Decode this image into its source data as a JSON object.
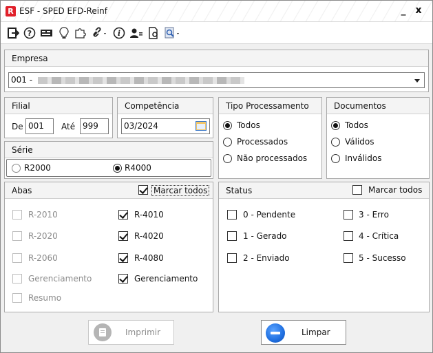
{
  "window": {
    "title": "ESF - SPED EFD-Reinf",
    "minimize": "_",
    "close": "x"
  },
  "toolbar": {
    "icons": [
      "exit-icon",
      "help-icon",
      "card-icon",
      "lightbulb-icon",
      "puzzle-icon",
      "link-icon",
      "info-icon",
      "user-icon",
      "document-settings-icon",
      "search-report-icon"
    ]
  },
  "empresa": {
    "header": "Empresa",
    "value": "001 -"
  },
  "filial": {
    "header": "Filial",
    "de_label": "De",
    "de_value": "001",
    "ate_label": "Até",
    "ate_value": "999"
  },
  "competencia": {
    "header": "Competência",
    "value": "03/2024"
  },
  "serie": {
    "header": "Série",
    "options": [
      {
        "label": "R2000",
        "selected": false
      },
      {
        "label": "R4000",
        "selected": true
      }
    ]
  },
  "tipo_processamento": {
    "header": "Tipo Processamento",
    "options": [
      {
        "label": "Todos",
        "selected": true
      },
      {
        "label": "Processados",
        "selected": false
      },
      {
        "label": "Não processados",
        "selected": false
      }
    ]
  },
  "documentos": {
    "header": "Documentos",
    "options": [
      {
        "label": "Todos",
        "selected": true
      },
      {
        "label": "Válidos",
        "selected": false
      },
      {
        "label": "Inválidos",
        "selected": false
      }
    ]
  },
  "abas": {
    "header": "Abas",
    "marcar_todos": "Marcar todos",
    "marcar_todos_checked": true,
    "left": [
      {
        "label": "R-2010",
        "checked": false,
        "disabled": true
      },
      {
        "label": "R-2020",
        "checked": false,
        "disabled": true
      },
      {
        "label": "R-2060",
        "checked": false,
        "disabled": true
      },
      {
        "label": "Gerenciamento",
        "checked": false,
        "disabled": true
      },
      {
        "label": "Resumo",
        "checked": false,
        "disabled": true
      }
    ],
    "right": [
      {
        "label": "R-4010",
        "checked": true,
        "disabled": false
      },
      {
        "label": "R-4020",
        "checked": true,
        "disabled": false
      },
      {
        "label": "R-4080",
        "checked": true,
        "disabled": false
      },
      {
        "label": "Gerenciamento",
        "checked": true,
        "disabled": false
      }
    ]
  },
  "status": {
    "header": "Status",
    "marcar_todos": "Marcar todos",
    "marcar_todos_checked": false,
    "left": [
      {
        "label": "0 - Pendente",
        "checked": false
      },
      {
        "label": "1 - Gerado",
        "checked": false
      },
      {
        "label": "2 - Enviado",
        "checked": false
      }
    ],
    "right": [
      {
        "label": "3 - Erro",
        "checked": false
      },
      {
        "label": "4 - Crítica",
        "checked": false
      },
      {
        "label": "5 - Sucesso",
        "checked": false
      }
    ]
  },
  "buttons": {
    "imprimir": "Imprimir",
    "limpar": "Limpar"
  },
  "colors": {
    "app_icon": "#e0202a",
    "limpar_icon": "#1f6fe0",
    "imprimir_icon": "#b5b5b5"
  }
}
